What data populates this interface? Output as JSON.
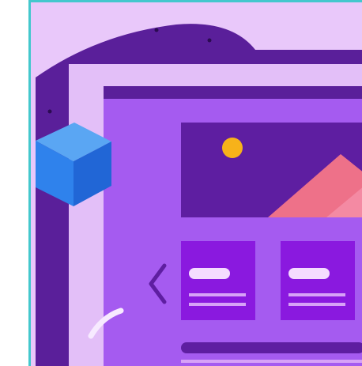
{
  "illustration": {
    "subject": "website-layout-illustration",
    "colors": {
      "frame_border": "#43c8cd",
      "background": "#e9c8fa",
      "dark_purple": "#5a1f9a",
      "light_purple_panel": "#dcb4f6",
      "main_panel": "#a55bf0",
      "card": "#8a19df",
      "image_bg": "#5e1ea1",
      "sun": "#f7b21a",
      "mountain_front": "#f06e8f",
      "mountain_back": "#e2637f",
      "cube_top": "#5aa6f3",
      "cube_left": "#2f82ec",
      "cube_right": "#2166d6",
      "arrow": "#5e1ea1",
      "white_line": "#f1d9ff"
    },
    "icons": {
      "arrow": "chevron-left-icon",
      "cube": "cube-icon",
      "sun": "sun-icon",
      "mountain": "mountain-icon"
    }
  }
}
